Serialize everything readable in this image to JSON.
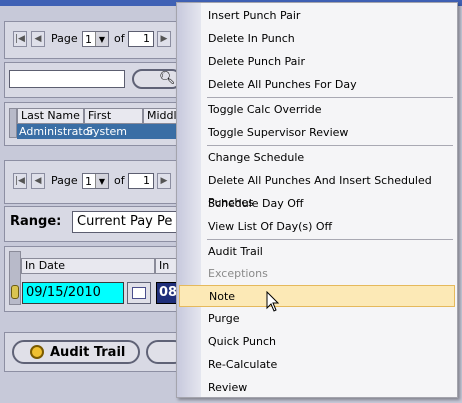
{
  "pager_top": {
    "page_label": "Page",
    "page_value": "1",
    "of_label": "of",
    "total_value": "1"
  },
  "search": {
    "value": "",
    "icon": "search-icon"
  },
  "employee_table": {
    "headers": [
      "Last Name",
      "First Name",
      "Middle"
    ],
    "selected_row": [
      "Administrator",
      "System",
      ""
    ]
  },
  "pager_bottom": {
    "page_label": "Page",
    "page_value": "1",
    "of_label": "of",
    "total_value": "1"
  },
  "range": {
    "label": "Range:",
    "value": "Current Pay Pe"
  },
  "punch_table": {
    "headers": [
      "In Date",
      "In"
    ],
    "in_date_value": "09/15/2010",
    "in_time_partial": "08"
  },
  "audit_trail_button": {
    "label": "Audit Trail"
  },
  "context_menu": {
    "items": [
      {
        "label": "Insert Punch Pair"
      },
      {
        "label": "Delete In Punch"
      },
      {
        "label": "Delete Punch Pair"
      },
      {
        "label": "Delete All Punches For Day"
      },
      {
        "label": "Toggle Calc Override"
      },
      {
        "label": "Toggle Supervisor Review"
      },
      {
        "label": "Change Schedule"
      },
      {
        "label": "Delete All Punches And Insert Scheduled Punches"
      },
      {
        "label": "Schedule Day Off"
      },
      {
        "label": "View List Of Day(s) Off"
      },
      {
        "label": "Audit Trail"
      },
      {
        "label": "Exceptions",
        "disabled": true
      },
      {
        "label": "Note",
        "highlighted": true
      },
      {
        "label": "Purge"
      },
      {
        "label": "Quick Punch"
      },
      {
        "label": "Re-Calculate"
      },
      {
        "label": "Review"
      }
    ]
  },
  "colors": {
    "selection": "#3a6ea5",
    "date_field": "#00ffff",
    "menu_highlight": "#fce9b6"
  }
}
